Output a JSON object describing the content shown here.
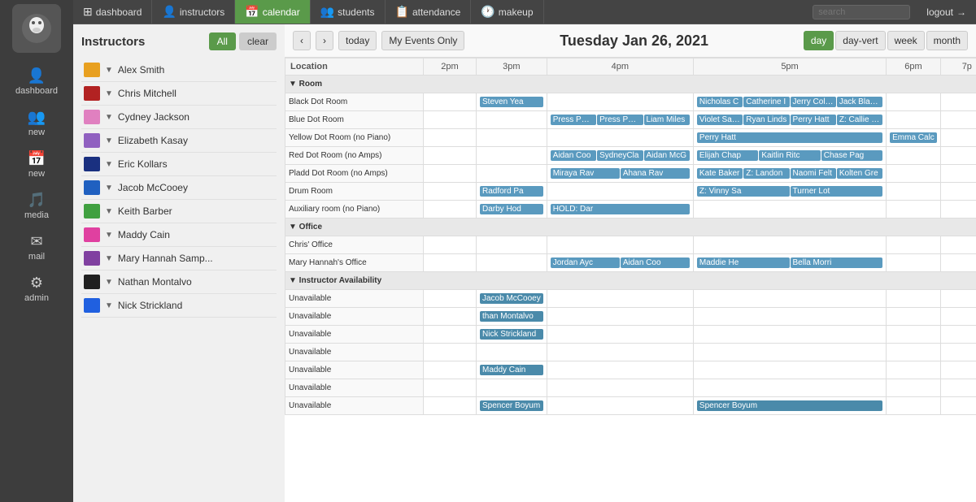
{
  "app": {
    "logo_alt": "Dance Studio Logo"
  },
  "nav": {
    "items": [
      {
        "label": "dashboard",
        "icon": "⊞",
        "active": false
      },
      {
        "label": "instructors",
        "icon": "👤",
        "active": false
      },
      {
        "label": "calendar",
        "icon": "📅",
        "active": true
      },
      {
        "label": "students",
        "icon": "👥",
        "active": false
      },
      {
        "label": "attendance",
        "icon": "📋",
        "active": false
      },
      {
        "label": "makeup",
        "icon": "🕐",
        "active": false
      }
    ],
    "search_placeholder": "search",
    "logout_label": "logout"
  },
  "sidebar": {
    "title": "Instructors",
    "all_label": "All",
    "clear_label": "clear",
    "instructors": [
      {
        "name": "Alex Smith",
        "color": "#e8a020"
      },
      {
        "name": "Chris Mitchell",
        "color": "#b22222"
      },
      {
        "name": "Cydney Jackson",
        "color": "#e080c0"
      },
      {
        "name": "Elizabeth Kasay",
        "color": "#9060c0"
      },
      {
        "name": "Eric Kollars",
        "color": "#1a3080"
      },
      {
        "name": "Jacob McCooey",
        "color": "#2060c0"
      },
      {
        "name": "Keith Barber",
        "color": "#40a040"
      },
      {
        "name": "Maddy Cain",
        "color": "#e040a0"
      },
      {
        "name": "Mary Hannah Samp...",
        "color": "#8040a0"
      },
      {
        "name": "Nathan Montalvo",
        "color": "#202020"
      },
      {
        "name": "Nick Strickland",
        "color": "#2060e0"
      }
    ]
  },
  "calendar": {
    "prev_label": "‹",
    "next_label": "›",
    "today_label": "today",
    "my_events_label": "My Events Only",
    "title": "Tuesday Jan 26, 2021",
    "views": [
      "day",
      "day-vert",
      "week",
      "month"
    ],
    "active_view": "day",
    "time_headers": [
      "2pm",
      "3pm",
      "4pm",
      "5pm",
      "6pm",
      "7p"
    ],
    "sections": [
      {
        "name": "Room",
        "rows": [
          {
            "location": "Black Dot Room",
            "events": [
              {
                "col": 2,
                "label": "Steven Yea",
                "color": "#5a9abf"
              },
              {
                "col": 4,
                "label": "Nicholas C",
                "color": "#5a9abf"
              },
              {
                "col": 4,
                "label": "Catherine I",
                "color": "#5a9abf"
              },
              {
                "col": 4,
                "label": "Jerry Colso",
                "color": "#5a9abf"
              },
              {
                "col": 4,
                "label": "Jack Blackn",
                "color": "#5a9abf"
              }
            ]
          },
          {
            "location": "Blue Dot Room",
            "events": [
              {
                "col": 3,
                "label": "Press Pope",
                "color": "#5a9abf"
              },
              {
                "col": 3,
                "label": "Press Pope",
                "color": "#5a9abf"
              },
              {
                "col": 3,
                "label": "Liam Miles",
                "color": "#5a9abf"
              },
              {
                "col": 4,
                "label": "Violet Sapp",
                "color": "#5a9abf"
              },
              {
                "col": 4,
                "label": "Ryan Linds",
                "color": "#5a9abf"
              },
              {
                "col": 4,
                "label": "Perry Hatt",
                "color": "#5a9abf"
              },
              {
                "col": 4,
                "label": "Z: Callie Ba",
                "color": "#5a9abf"
              }
            ]
          },
          {
            "location": "Yellow Dot Room  (no Piano)",
            "events": [
              {
                "col": 4,
                "label": "Perry Hatt",
                "color": "#5a9abf"
              },
              {
                "col": 5,
                "label": "Emma Calc",
                "color": "#5a9abf"
              }
            ]
          },
          {
            "location": "Red Dot Room  (no Amps)",
            "events": [
              {
                "col": 3,
                "label": "Aidan Coo",
                "color": "#5a9abf"
              },
              {
                "col": 3,
                "label": "SydneyCla",
                "color": "#5a9abf"
              },
              {
                "col": 3,
                "label": "Aidan McG",
                "color": "#5a9abf"
              },
              {
                "col": 4,
                "label": "Elijah Chap",
                "color": "#5a9abf"
              },
              {
                "col": 4,
                "label": "Kaitlin Ritc",
                "color": "#5a9abf"
              },
              {
                "col": 4,
                "label": "Chase Pag",
                "color": "#5a9abf"
              }
            ]
          },
          {
            "location": "Pladd Dot Room  (no Amps)",
            "events": [
              {
                "col": 3,
                "label": "Miraya Rav",
                "color": "#5a9abf"
              },
              {
                "col": 3,
                "label": "Ahana Rav",
                "color": "#5a9abf"
              },
              {
                "col": 4,
                "label": "Kate Baker",
                "color": "#5a9abf"
              },
              {
                "col": 4,
                "label": "Z: Landon",
                "color": "#5a9abf"
              },
              {
                "col": 4,
                "label": "Naomi Felt",
                "color": "#5a9abf"
              },
              {
                "col": 4,
                "label": "Kolten Gre",
                "color": "#5a9abf"
              }
            ]
          },
          {
            "location": "Drum Room",
            "events": [
              {
                "col": 2,
                "label": "Radford Pa",
                "color": "#5a9abf"
              },
              {
                "col": 4,
                "label": "Z: Vinny Sa",
                "color": "#5a9abf"
              },
              {
                "col": 4,
                "label": "Turner Lot",
                "color": "#5a9abf"
              }
            ]
          },
          {
            "location": "Auxiliary room  (no Piano)",
            "events": [
              {
                "col": 2,
                "label": "Darby Hod",
                "color": "#5a9abf"
              },
              {
                "col": 3,
                "label": "HOLD: Dar",
                "color": "#5a9abf"
              }
            ]
          }
        ]
      },
      {
        "name": "Office",
        "rows": [
          {
            "location": "Chris' Office",
            "events": []
          },
          {
            "location": "Mary Hannah's Office",
            "events": [
              {
                "col": 3,
                "label": "Jordan Ayc",
                "color": "#5a9abf"
              },
              {
                "col": 3,
                "label": "Aidan Coo",
                "color": "#5a9abf"
              },
              {
                "col": 4,
                "label": "Maddie He",
                "color": "#5a9abf"
              },
              {
                "col": 4,
                "label": "Bella Morri",
                "color": "#5a9abf"
              }
            ]
          }
        ]
      },
      {
        "name": "Instructor Availability",
        "rows": [
          {
            "location": "Unavailable",
            "events": [
              {
                "col": 2,
                "label": "Jacob McCooey",
                "color": "#4a8aaa",
                "span": 3
              }
            ]
          },
          {
            "location": "Unavailable",
            "events": [
              {
                "col": 2,
                "label": "than Montalvo",
                "color": "#4a8aaa",
                "span": 1
              }
            ]
          },
          {
            "location": "Unavailable",
            "events": [
              {
                "col": 2,
                "label": "Nick Strickland",
                "color": "#4a8aaa",
                "span": 2
              }
            ]
          },
          {
            "location": "Unavailable",
            "events": []
          },
          {
            "location": "Unavailable",
            "events": [
              {
                "col": 2,
                "label": "Maddy Cain",
                "color": "#4a8aaa",
                "span": 3
              }
            ]
          },
          {
            "location": "Unavailable",
            "events": []
          },
          {
            "location": "Unavailable",
            "events": [
              {
                "col": 2,
                "label": "Spencer Boyum",
                "color": "#4a8aaa",
                "span": 3
              },
              {
                "col": 4,
                "label": "Spencer Boyum",
                "color": "#4a8aaa",
                "span": 1
              }
            ]
          }
        ]
      }
    ]
  }
}
